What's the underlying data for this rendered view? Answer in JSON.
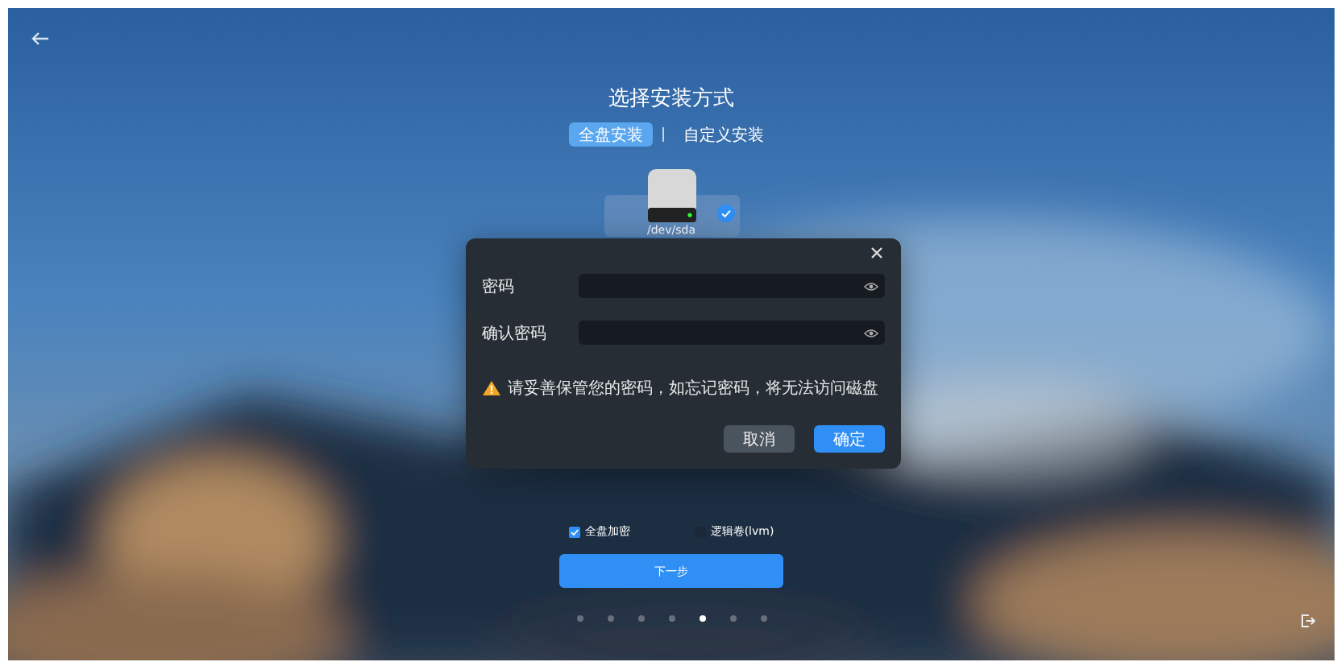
{
  "title": "选择安装方式",
  "tabs": [
    {
      "label": "全盘安装",
      "selected": true
    },
    {
      "label": "自定义安装",
      "selected": false
    }
  ],
  "disk": {
    "label": "/dev/sda",
    "selected": true
  },
  "dialog": {
    "fields": [
      {
        "label": "密码"
      },
      {
        "label": "确认密码"
      }
    ],
    "warning": "请妥善保管您的密码，如忘记密码，将无法访问磁盘",
    "buttons": [
      {
        "label": "取消",
        "kind": "secondary"
      },
      {
        "label": "确定",
        "kind": "primary"
      }
    ]
  },
  "options": [
    {
      "label": "全盘加密",
      "checked": true
    },
    {
      "label": "逻辑卷(lvm)",
      "checked": false
    }
  ],
  "next_button": "下一步",
  "pages": [
    {
      "selected": false
    },
    {
      "selected": false
    },
    {
      "selected": false
    },
    {
      "selected": false
    },
    {
      "selected": true
    },
    {
      "selected": false
    },
    {
      "selected": false
    }
  ]
}
